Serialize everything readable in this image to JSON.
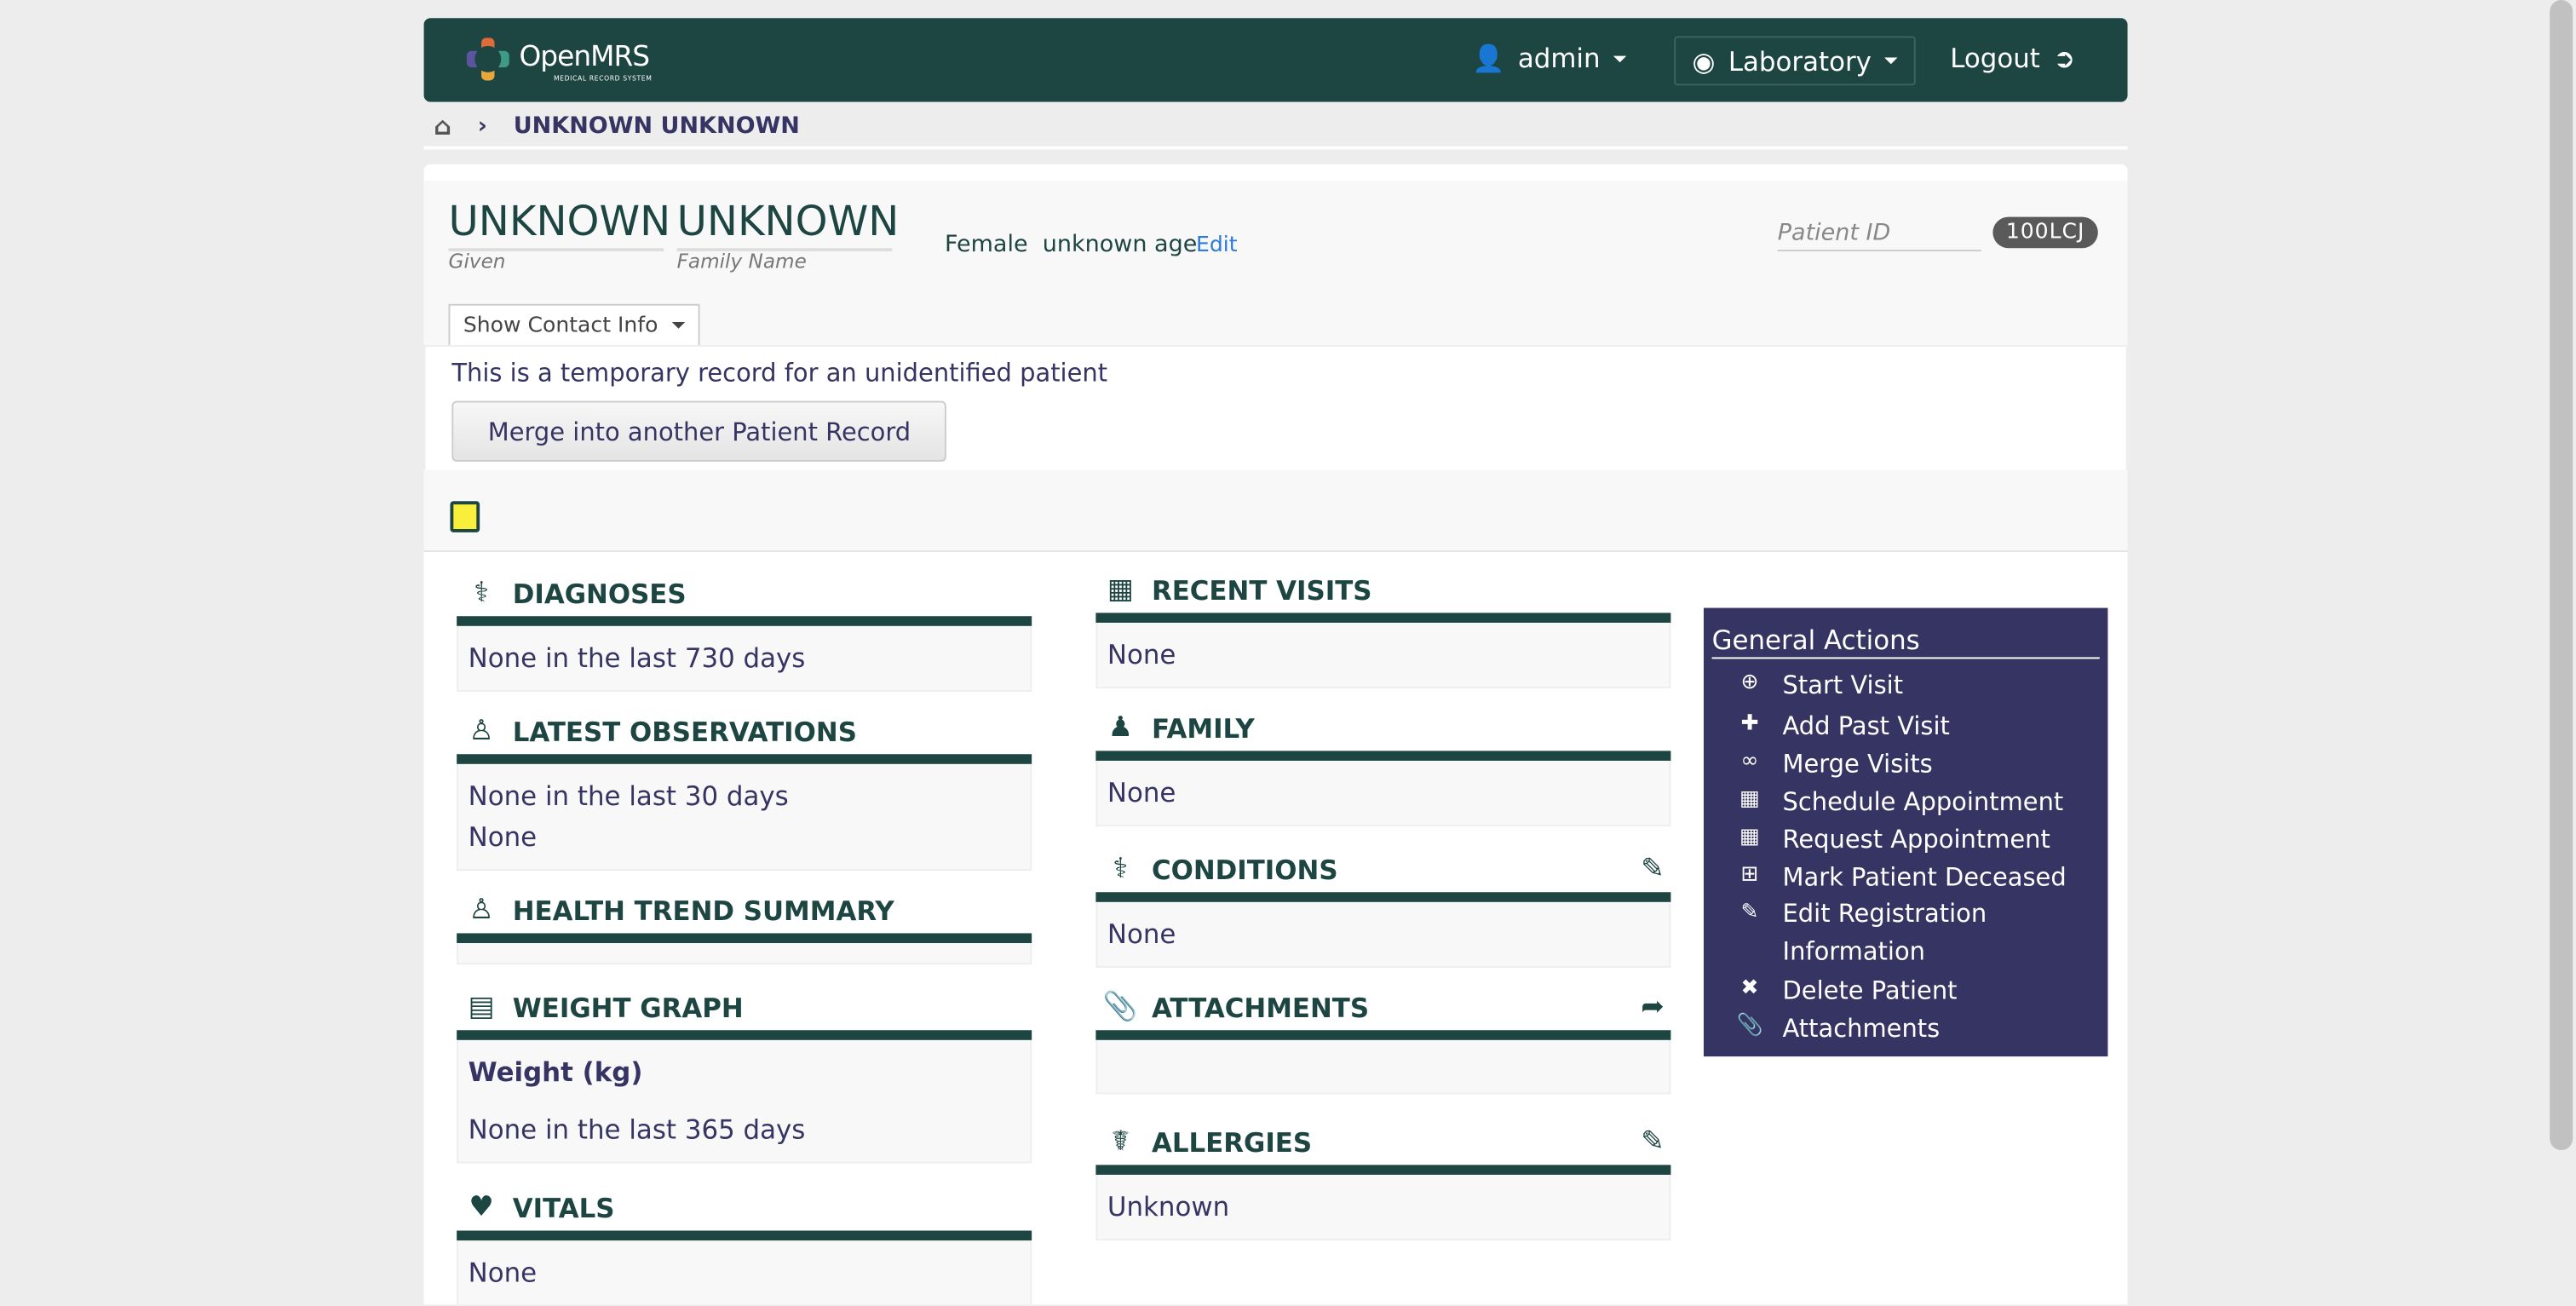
{
  "header": {
    "logo_text": "OpenMRS",
    "logo_sub": "MEDICAL RECORD SYSTEM",
    "user": "admin",
    "location": "Laboratory",
    "logout": "Logout",
    "color": "#1d4541"
  },
  "breadcrumb": {
    "current": "UNKNOWN UNKNOWN"
  },
  "patient": {
    "given": "UNKNOWN",
    "family": "UNKNOWN",
    "given_label": "Given",
    "family_label": "Family Name",
    "gender": "Female",
    "age": "unknown age",
    "edit": "Edit",
    "id_label": "Patient ID",
    "id": "100LCJ",
    "contact_button": "Show Contact Info"
  },
  "temp": {
    "message": "This is a temporary record for an unidentified patient",
    "merge_button": "Merge into another Patient Record"
  },
  "cards": {
    "diagnoses": {
      "title": "DIAGNOSES",
      "lines": [
        "None in the last 730 days"
      ]
    },
    "observations": {
      "title": "LATEST OBSERVATIONS",
      "lines": [
        "None in the last 30 days",
        "None"
      ]
    },
    "health_trend": {
      "title": "HEALTH TREND SUMMARY"
    },
    "weight": {
      "title": "WEIGHT GRAPH",
      "lines": [
        "Weight (kg)",
        "None in the last 365 days"
      ]
    },
    "vitals": {
      "title": "VITALS",
      "lines": [
        "None"
      ]
    },
    "visits": {
      "title": "RECENT VISITS",
      "lines": [
        "None"
      ]
    },
    "family": {
      "title": "FAMILY",
      "lines": [
        "None"
      ]
    },
    "conditions": {
      "title": "CONDITIONS",
      "lines": [
        "None"
      ]
    },
    "attachments": {
      "title": "ATTACHMENTS"
    },
    "allergies": {
      "title": "ALLERGIES",
      "lines": [
        "Unknown"
      ]
    }
  },
  "general_actions": {
    "title": "General Actions",
    "color": "#363463",
    "items": [
      {
        "label": "Start Visit",
        "icon": "map-marker-plus-icon"
      },
      {
        "label": "Add Past Visit",
        "icon": "plus-icon"
      },
      {
        "label": "Merge Visits",
        "icon": "link-icon"
      },
      {
        "label": "Schedule Appointment",
        "icon": "calendar-icon"
      },
      {
        "label": "Request Appointment",
        "icon": "calendar-icon"
      },
      {
        "label": "Mark Patient Deceased",
        "icon": "plus-square-icon"
      },
      {
        "label": "Edit Registration Information",
        "icon": "pencil-icon"
      },
      {
        "label": "Delete Patient",
        "icon": "x-icon"
      },
      {
        "label": "Attachments",
        "icon": "paperclip-icon"
      }
    ]
  }
}
